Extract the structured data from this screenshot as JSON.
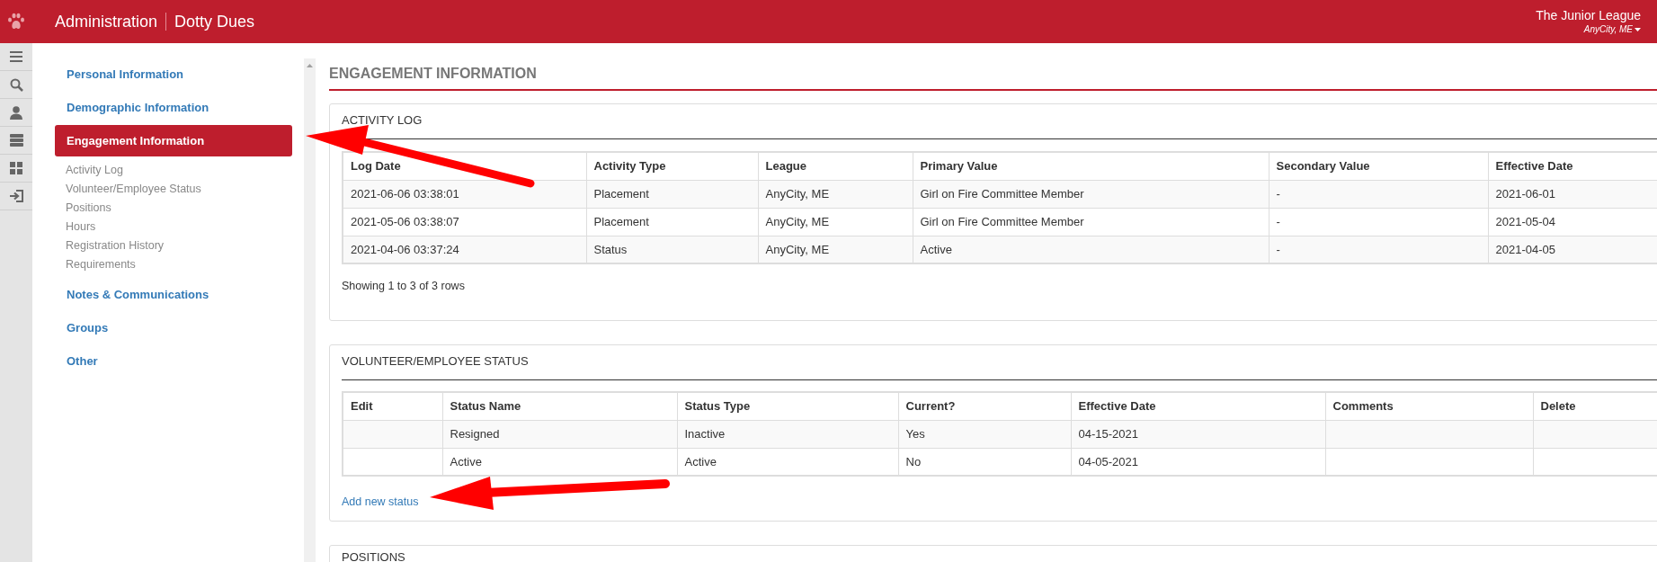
{
  "header": {
    "title": "Administration",
    "app_name": "Dotty Dues",
    "org": "The Junior League",
    "location": "AnyCity, ME"
  },
  "rail": [
    {
      "kind": "menu"
    },
    {
      "kind": "search"
    },
    {
      "kind": "user"
    },
    {
      "kind": "server"
    },
    {
      "kind": "grid"
    },
    {
      "kind": "logout"
    }
  ],
  "sidebar": {
    "items": [
      {
        "label": "Personal Information",
        "selected": false
      },
      {
        "label": "Demographic Information",
        "selected": false
      },
      {
        "label": "Engagement Information",
        "selected": true,
        "children": [
          {
            "label": "Activity Log"
          },
          {
            "label": "Volunteer/Employee Status"
          },
          {
            "label": "Positions"
          },
          {
            "label": "Hours"
          },
          {
            "label": "Registration History"
          },
          {
            "label": "Requirements"
          }
        ]
      },
      {
        "label": "Notes & Communications",
        "selected": false
      },
      {
        "label": "Groups",
        "selected": false
      },
      {
        "label": "Other",
        "selected": false
      }
    ]
  },
  "page_title": "ENGAGEMENT INFORMATION",
  "activity_log": {
    "title": "ACTIVITY LOG",
    "columns": [
      "Log Date",
      "Activity Type",
      "League",
      "Primary Value",
      "Secondary Value",
      "Effective Date"
    ],
    "rows": [
      [
        "2021-06-06 03:38:01",
        "Placement",
        "AnyCity, ME",
        "Girl on Fire Committee Member",
        "-",
        "2021-06-01"
      ],
      [
        "2021-05-06 03:38:07",
        "Placement",
        "AnyCity, ME",
        "Girl on Fire Committee Member",
        "-",
        "2021-05-04"
      ],
      [
        "2021-04-06 03:37:24",
        "Status",
        "AnyCity, ME",
        "Active",
        "-",
        "2021-04-05"
      ]
    ],
    "footer": "Showing 1 to 3 of 3 rows"
  },
  "status": {
    "title": "VOLUNTEER/EMPLOYEE STATUS",
    "columns": [
      "Edit",
      "Status Name",
      "Status Type",
      "Current?",
      "Effective Date",
      "Comments",
      "Delete"
    ],
    "rows": [
      [
        "",
        "Resigned",
        "Inactive",
        "Yes",
        "04-15-2021",
        "",
        ""
      ],
      [
        "",
        "Active",
        "Active",
        "No",
        "04-05-2021",
        "",
        ""
      ]
    ],
    "add_link": "Add new status"
  },
  "positions": {
    "title": "POSITIONS"
  }
}
